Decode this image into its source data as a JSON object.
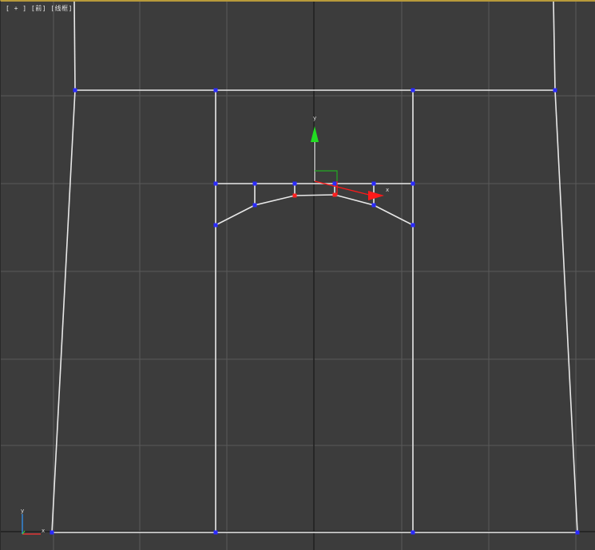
{
  "viewport": {
    "label": "[ + ] [前] [线框]",
    "name": "Front"
  },
  "gizmo": {
    "y_label": "y",
    "x_label": "x",
    "x_color": "#ff1a1a",
    "y_color": "#22dd22"
  },
  "corner_axes": {
    "y_label": "y",
    "x_label": "x"
  },
  "colors": {
    "background": "#3c3c3c",
    "grid": "#5a5a5a",
    "grid_center": "#1e1e1e",
    "wire": "#e8e8e8",
    "vertex": "#2a2aff",
    "selected_vertex": "#ff2020",
    "viewport_border": "#b89a3a"
  }
}
